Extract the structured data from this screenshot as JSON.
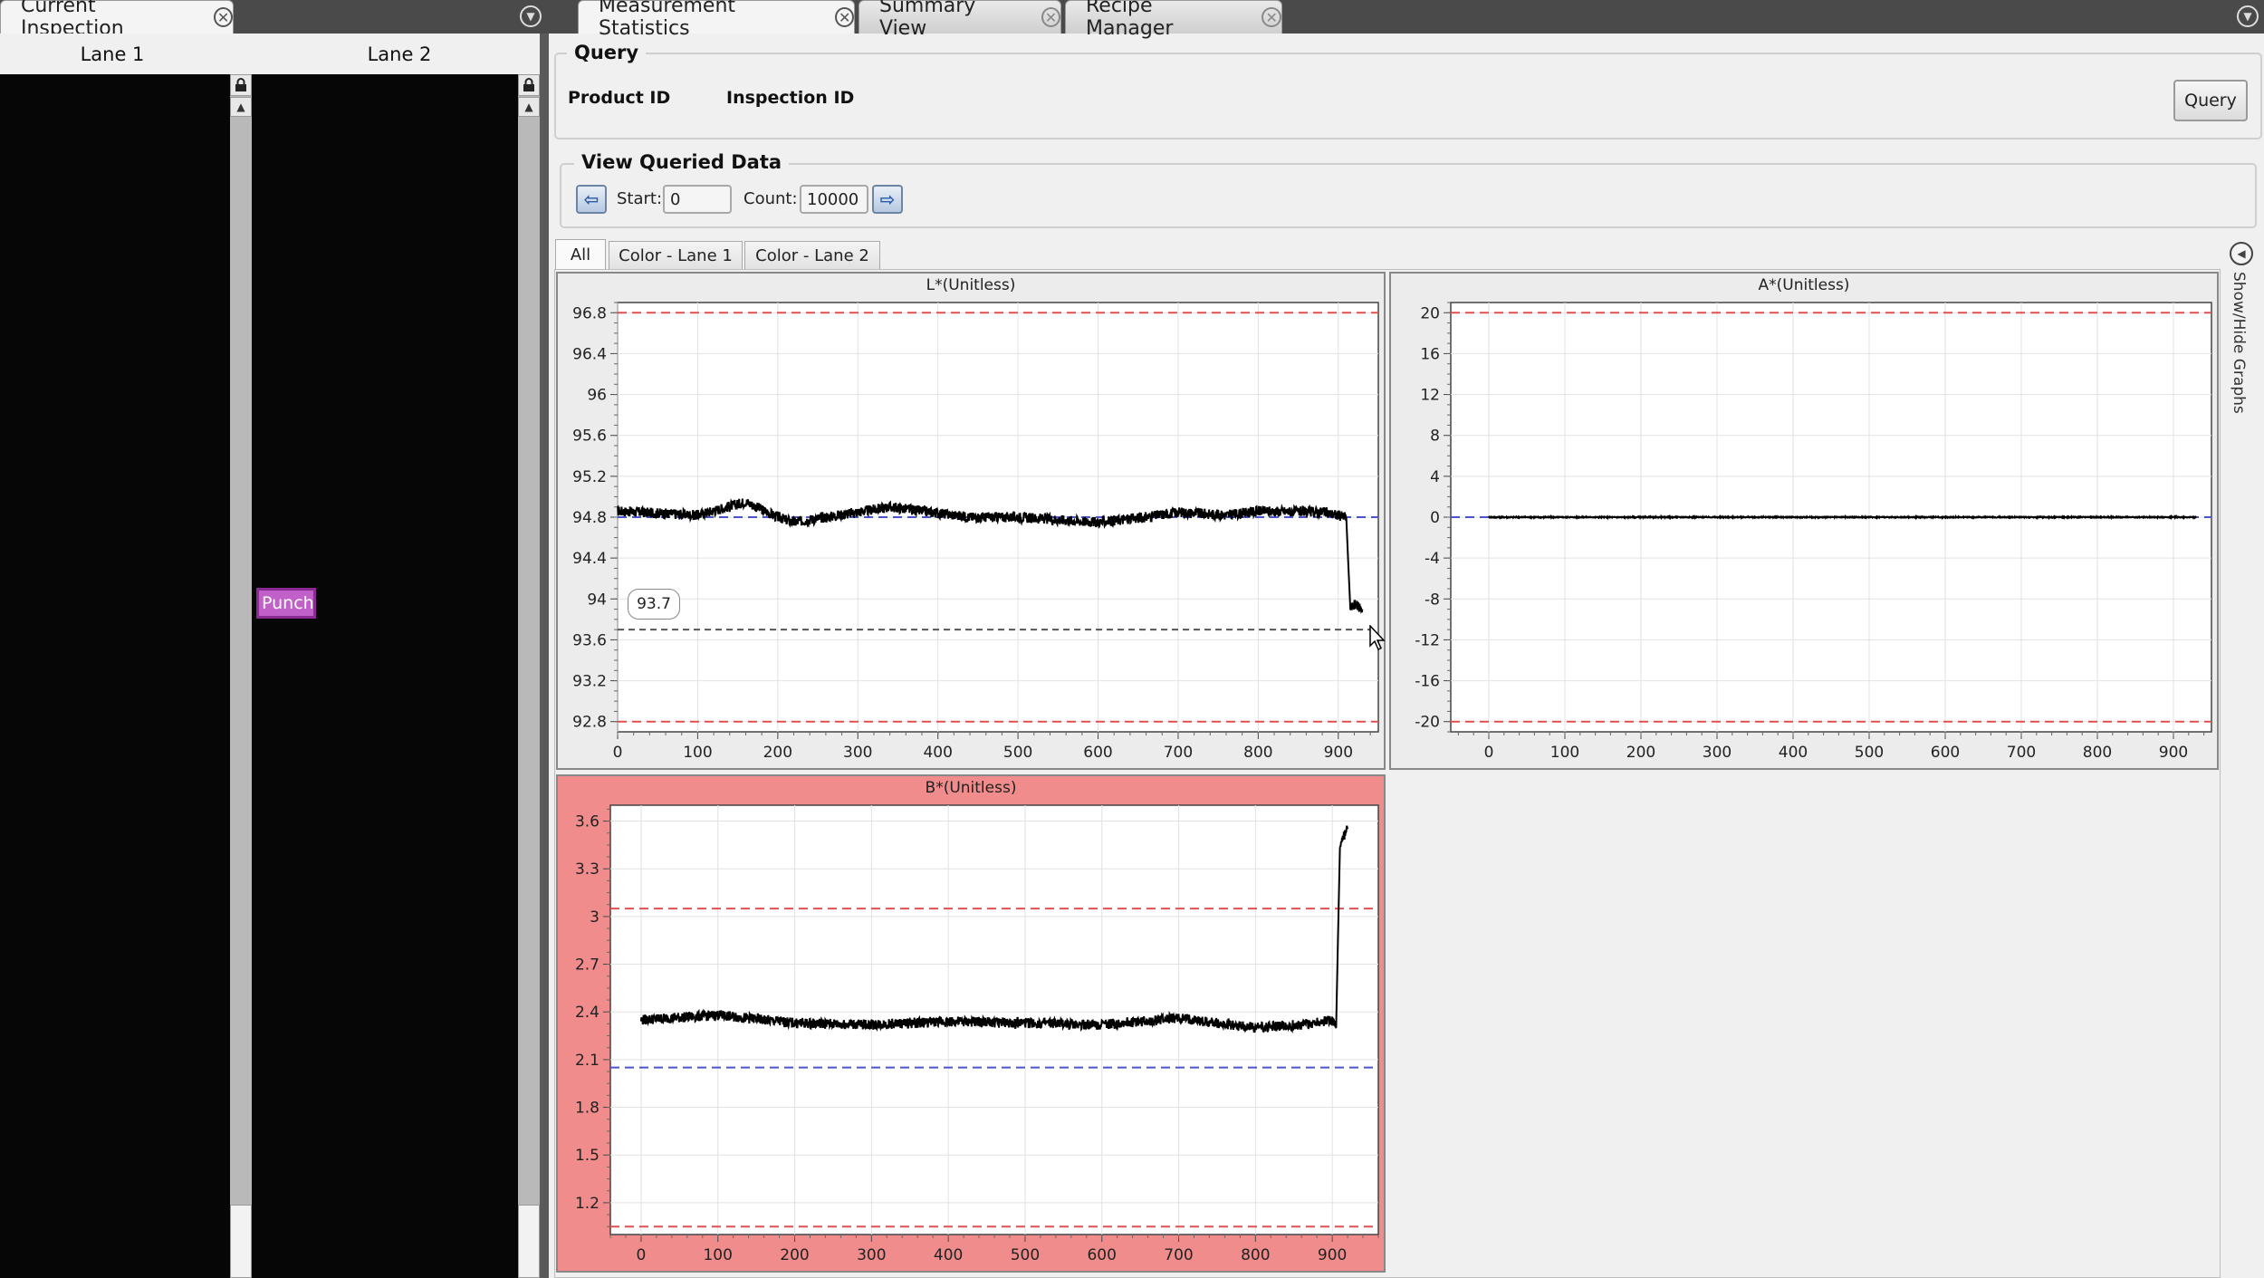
{
  "left_tabs": [
    {
      "label": "Current Inspection"
    }
  ],
  "main_tabs": [
    {
      "label": "Measurement Statistics",
      "active": true
    },
    {
      "label": "Summary View",
      "active": false
    },
    {
      "label": "Recipe Manager",
      "active": false
    }
  ],
  "lanes": {
    "lane1": "Lane 1",
    "lane2": "Lane 2",
    "overlay_label": "Punch"
  },
  "query": {
    "title": "Query",
    "product_id_label": "Product ID",
    "inspection_id_label": "Inspection ID",
    "button_label": "Query"
  },
  "view_queried": {
    "title": "View Queried Data",
    "start_label": "Start:",
    "start_value": "0",
    "count_label": "Count:",
    "count_value": "10000"
  },
  "sub_tabs": [
    "All",
    "Color - Lane 1",
    "Color - Lane 2"
  ],
  "side_label": "Show/Hide Graphs",
  "chart_data": [
    {
      "type": "line",
      "title": "L*(Unitless)",
      "xlim": [
        0,
        950
      ],
      "xticks": [
        0,
        100,
        200,
        300,
        400,
        500,
        600,
        700,
        800,
        900
      ],
      "ylim": [
        92.7,
        96.9
      ],
      "yticks": [
        92.8,
        93.2,
        93.6,
        94,
        94.4,
        94.8,
        95.2,
        95.6,
        96,
        96.4,
        96.8
      ],
      "upper_limit": 96.8,
      "lower_limit": 92.8,
      "target": 94.8,
      "cursor_value": 93.7,
      "callout_label": "93.7",
      "series": [
        {
          "x": [
            0,
            100,
            160,
            200,
            220,
            300,
            340,
            390,
            440,
            500,
            600,
            660,
            700,
            760,
            800,
            880,
            900,
            910,
            915,
            920,
            930
          ],
          "y": [
            94.86,
            94.82,
            94.95,
            94.8,
            94.75,
            94.85,
            94.9,
            94.85,
            94.8,
            94.8,
            94.75,
            94.8,
            94.85,
            94.82,
            94.86,
            94.85,
            94.82,
            94.8,
            93.9,
            93.95,
            93.9
          ]
        }
      ],
      "alarm": false
    },
    {
      "type": "line",
      "title": "A*(Unitless)",
      "xlim": [
        -50,
        950
      ],
      "xticks": [
        0,
        100,
        200,
        300,
        400,
        500,
        600,
        700,
        800,
        900
      ],
      "ylim": [
        -21,
        21
      ],
      "yticks": [
        -20,
        -16,
        -12,
        -8,
        -4,
        0,
        4,
        8,
        12,
        16,
        20
      ],
      "upper_limit": 20,
      "lower_limit": -20,
      "target": 0,
      "series": [
        {
          "x": [
            0,
            930
          ],
          "y": [
            0,
            0
          ]
        }
      ],
      "alarm": false
    },
    {
      "type": "line",
      "title": "B*(Unitless)",
      "xlim": [
        -40,
        960
      ],
      "xticks": [
        0,
        100,
        200,
        300,
        400,
        500,
        600,
        700,
        800,
        900
      ],
      "ylim": [
        1.0,
        3.7
      ],
      "yticks": [
        1.2,
        1.5,
        1.8,
        2.1,
        2.4,
        2.7,
        3,
        3.3,
        3.6
      ],
      "upper_limit": 3.05,
      "lower_limit": 1.05,
      "target": 2.05,
      "series": [
        {
          "x": [
            0,
            100,
            200,
            300,
            400,
            500,
            600,
            700,
            800,
            860,
            900,
            905,
            910,
            920
          ],
          "y": [
            2.35,
            2.38,
            2.33,
            2.32,
            2.34,
            2.33,
            2.32,
            2.36,
            2.3,
            2.32,
            2.35,
            2.3,
            3.45,
            3.55
          ]
        }
      ],
      "alarm": true
    }
  ]
}
